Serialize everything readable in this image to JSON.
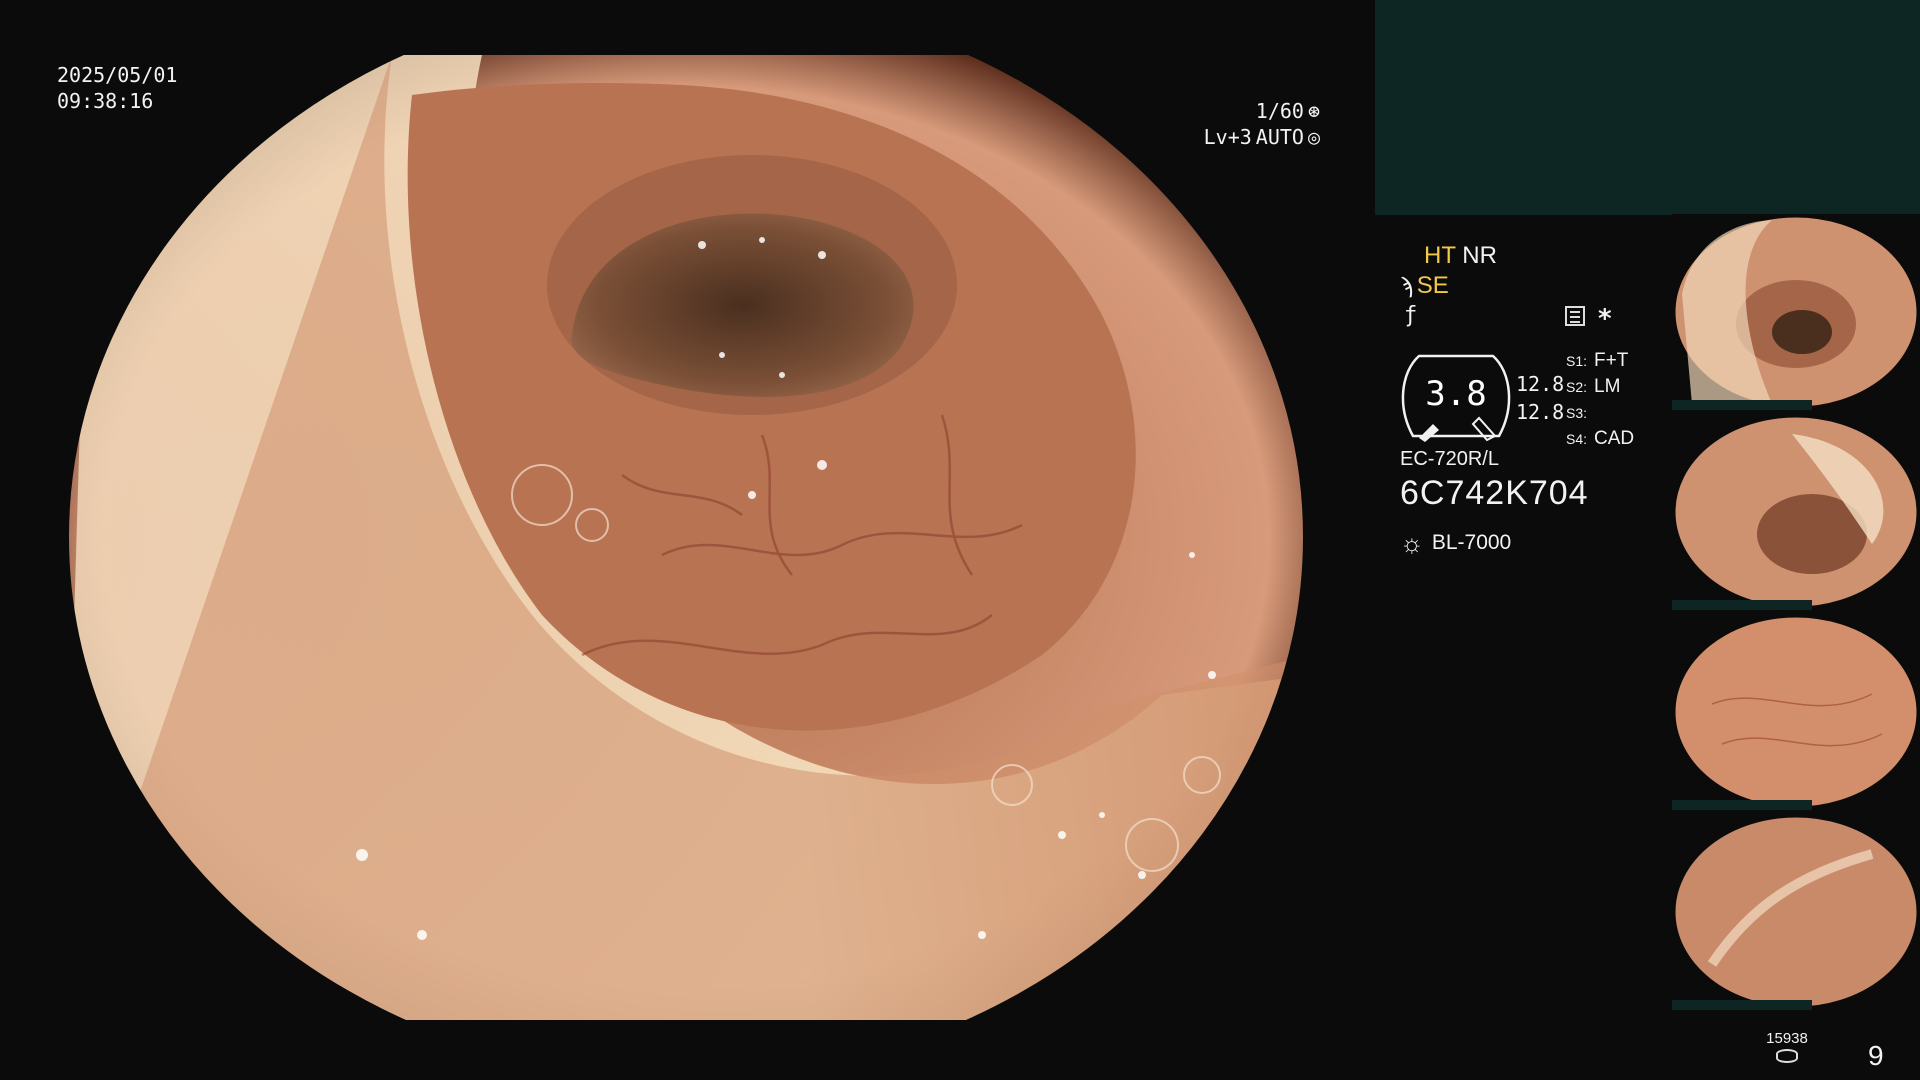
{
  "overlay": {
    "date": "2025/05/01",
    "time": "09:38:16",
    "shutter": "1/60",
    "shutter_icon": "aperture-icon",
    "level": "Lv+3",
    "mode": "AUTO",
    "mode_icon": "target-icon"
  },
  "panel": {
    "ht": "HT",
    "nr": "NR",
    "se": "SE",
    "hook_icon": "ϡ",
    "curl_icon": "ƒ",
    "monitor_icon": "monitor-icon",
    "asterisk": "*",
    "gauge_value": "3.8",
    "gauge_val_1": "12.8",
    "gauge_val_2": "12.8",
    "settings": [
      {
        "key": "S1:",
        "value": "F+T"
      },
      {
        "key": "S2:",
        "value": "LM"
      },
      {
        "key": "S3:",
        "value": ""
      },
      {
        "key": "S4:",
        "value": "CAD"
      }
    ],
    "scope_model": "EC-720R/L",
    "scope_serial": "6C742K704",
    "light_source": "BL-7000",
    "light_icon": "sun-icon",
    "storage_count": "15938",
    "image_count": "9"
  },
  "colors": {
    "teal": "#0d2623",
    "tissue": "#c98a6a",
    "highlight": "#f3c94a"
  }
}
